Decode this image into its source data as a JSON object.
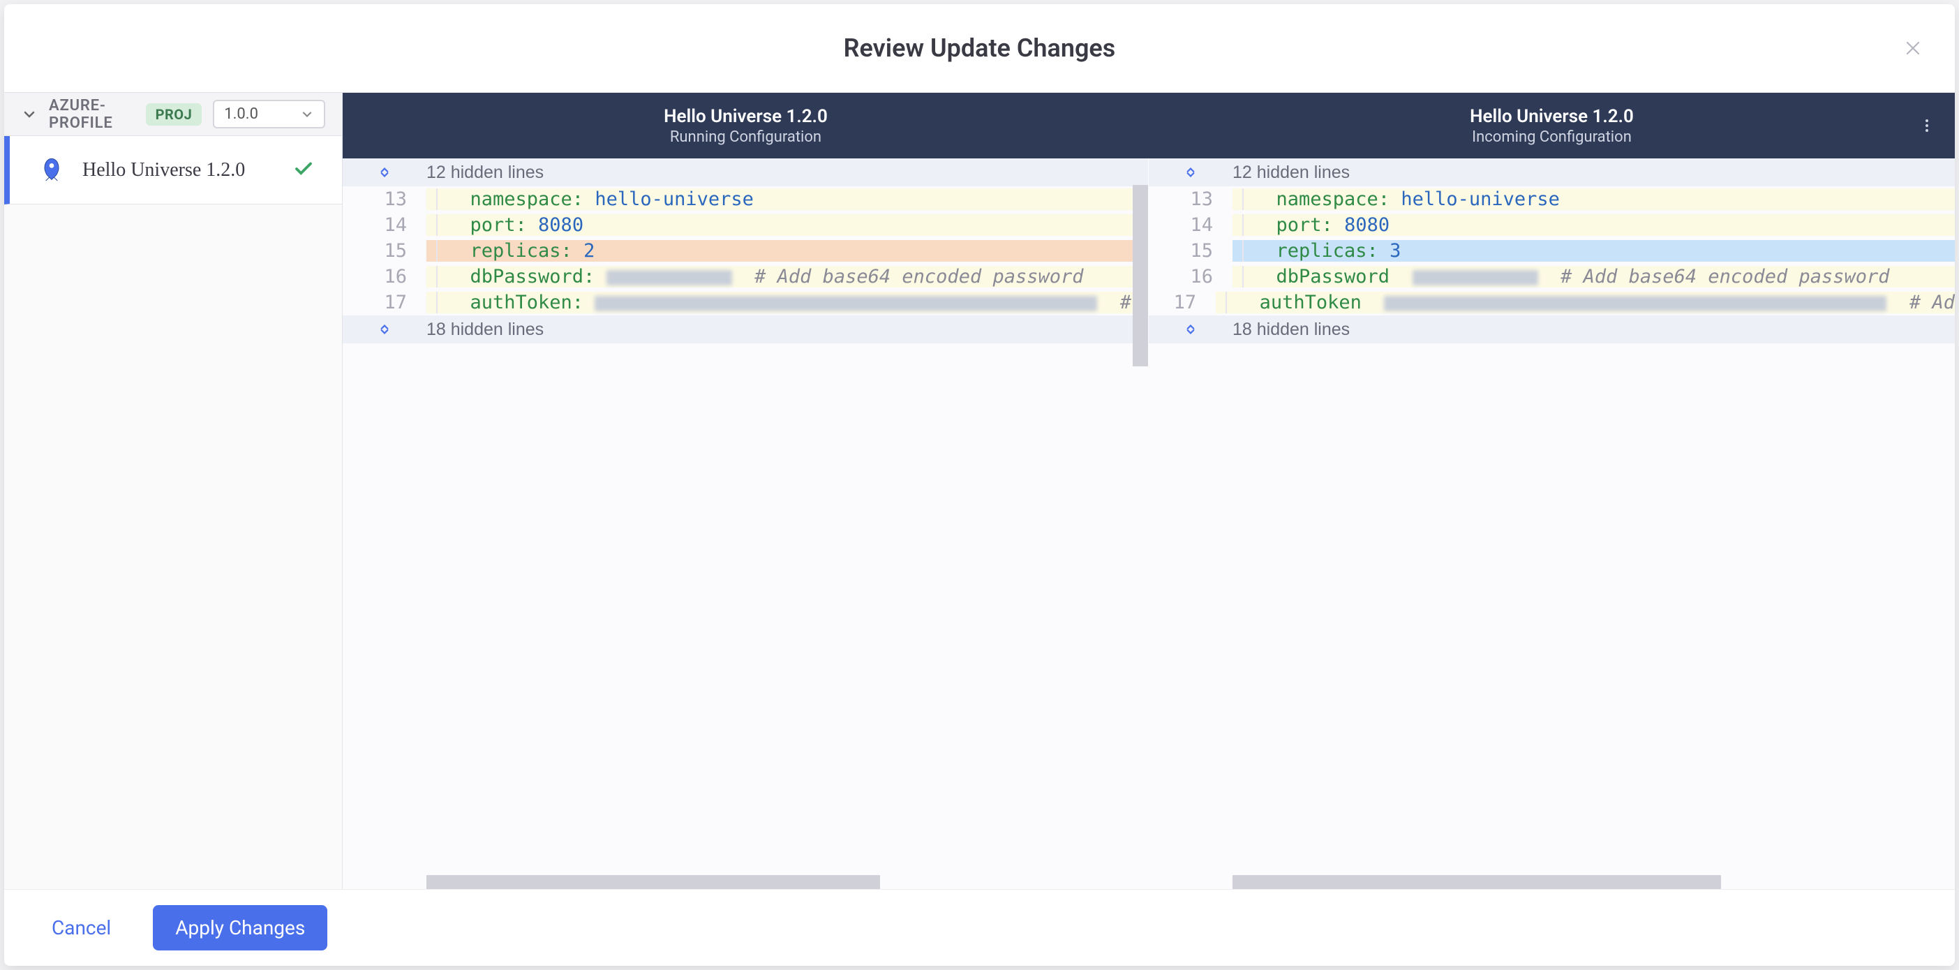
{
  "modal": {
    "title": "Review Update Changes"
  },
  "sidebar": {
    "profile_label": "AZURE-PROFILE",
    "proj_badge": "PROJ",
    "version_selected": "1.0.0",
    "item": {
      "label": "Hello Universe 1.2.0"
    }
  },
  "diff": {
    "left": {
      "title": "Hello Universe 1.2.0",
      "subtitle": "Running Configuration",
      "fold_top": "12 hidden lines",
      "fold_bottom": "18 hidden lines",
      "lines": [
        {
          "num": "13",
          "key": "namespace",
          "sep": ": ",
          "value": "hello-universe",
          "bg": "context"
        },
        {
          "num": "14",
          "key": "port",
          "sep": ": ",
          "value": "8080",
          "bg": "context"
        },
        {
          "num": "15",
          "key": "replicas",
          "sep": ": ",
          "value": "2",
          "bg": "removed"
        },
        {
          "num": "16",
          "key": "dbPassword",
          "sep": ": ",
          "censored_w": 180,
          "comment": "# Add base64 encoded password",
          "bg": "context"
        },
        {
          "num": "17",
          "key": "authToken",
          "sep": ": ",
          "censored_w": 720,
          "comment": "#",
          "bg": "context"
        }
      ]
    },
    "right": {
      "title": "Hello Universe 1.2.0",
      "subtitle": "Incoming Configuration",
      "fold_top": "12 hidden lines",
      "fold_bottom": "18 hidden lines",
      "lines": [
        {
          "num": "13",
          "key": "namespace",
          "sep": ": ",
          "value": "hello-universe",
          "bg": "context"
        },
        {
          "num": "14",
          "key": "port",
          "sep": ": ",
          "value": "8080",
          "bg": "context"
        },
        {
          "num": "15",
          "key": "replicas",
          "sep": ": ",
          "value": "3",
          "bg": "added"
        },
        {
          "num": "16",
          "key": "dbPassword",
          "sep": "  ",
          "censored_w": 180,
          "comment": "# Add base64 encoded password",
          "bg": "context"
        },
        {
          "num": "17",
          "key": "authToken",
          "sep": "  ",
          "censored_w": 720,
          "comment": "# Ad",
          "bg": "context"
        }
      ]
    }
  },
  "footer": {
    "cancel": "Cancel",
    "apply": "Apply Changes"
  }
}
